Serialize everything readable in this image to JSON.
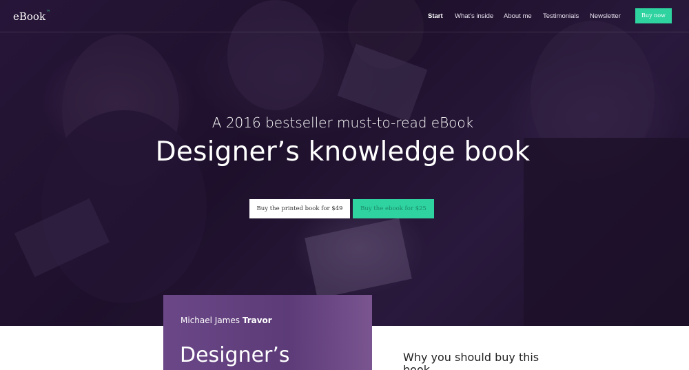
{
  "navbar": {
    "logo": "eBook",
    "logo_badge": "™",
    "items": [
      {
        "label": "Start",
        "active": true
      },
      {
        "label": "What's inside",
        "active": false
      },
      {
        "label": "About me",
        "active": false
      },
      {
        "label": "Testimonials",
        "active": false
      },
      {
        "label": "Newsletter",
        "active": false
      }
    ],
    "cta_label": "Buy now"
  },
  "hero": {
    "subtitle": "A 2016 bestseller must-to-read eBook",
    "headline": "Designer’s knowledge book",
    "buttons": {
      "printed": "Buy the printed book for $49",
      "ebook": "Buy the ebook for $25"
    }
  },
  "book_card": {
    "author_first": "Michael James",
    "author_last": "Travor",
    "title": "Designer’s"
  },
  "why_section": {
    "heading": "Why you should buy this book"
  },
  "colors": {
    "accent": "#2ed39f",
    "hero_overlay": "#2a1a3a",
    "book_card": "#6b4787"
  }
}
